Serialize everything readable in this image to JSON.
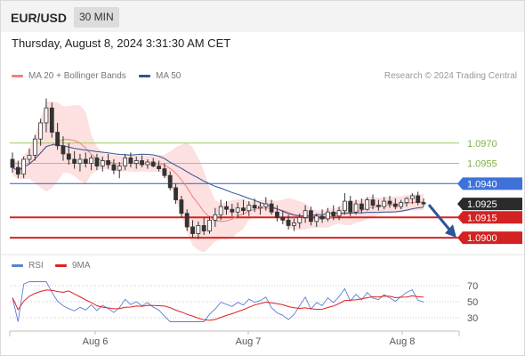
{
  "header": {
    "pair": "EUR/USD",
    "timeframe": "30 MIN"
  },
  "datetime": "Thursday, August 8, 2024 3:31:30 AM CET",
  "legend": [
    {
      "label": "MA 20 + Bollinger Bands",
      "color": "#f08080"
    },
    {
      "label": "MA 50",
      "color": "#2e5597"
    }
  ],
  "credit": "Research © 2024 Trading Central",
  "price_levels": [
    {
      "label": "1.0970",
      "value": 1.097,
      "kind": "resistance-weak",
      "color": "#9ccc65"
    },
    {
      "label": "1.0955",
      "value": 1.0955,
      "kind": "resistance-weak",
      "color": "#9ccc65"
    },
    {
      "label": "1.0940",
      "value": 1.094,
      "kind": "pivot",
      "color": "#3f72d8"
    },
    {
      "label": "1.0925",
      "value": 1.0925,
      "kind": "last-price",
      "color": "#2b2b2b"
    },
    {
      "label": "1.0915",
      "value": 1.0915,
      "kind": "support",
      "color": "#d32222"
    },
    {
      "label": "1.0900",
      "value": 1.09,
      "kind": "support",
      "color": "#d32222"
    }
  ],
  "rsi_legend": [
    {
      "label": "RSI",
      "color": "#5b7fd6"
    },
    {
      "label": "9MA",
      "color": "#e02020"
    }
  ],
  "rsi_levels": [
    "70",
    "50",
    "30"
  ],
  "x_labels": [
    "Aug 6",
    "Aug 7",
    "Aug 8"
  ],
  "chart_data": {
    "type": "candlestick",
    "price_range": [
      1.08915,
      1.101
    ],
    "candles_ohlc": [
      [
        1.0958,
        1.0963,
        1.0948,
        1.0952
      ],
      [
        1.0952,
        1.0957,
        1.0944,
        1.0947
      ],
      [
        1.0947,
        1.096,
        1.0944,
        1.0958
      ],
      [
        1.0958,
        1.0966,
        1.0955,
        1.0961
      ],
      [
        1.0961,
        1.0976,
        1.0957,
        1.0973
      ],
      [
        1.0973,
        1.0988,
        1.0968,
        1.0985
      ],
      [
        1.0985,
        1.1003,
        1.0978,
        1.0996
      ],
      [
        1.0996,
        1.1,
        1.0974,
        1.0978
      ],
      [
        1.0978,
        1.0985,
        1.0965,
        1.0968
      ],
      [
        1.0968,
        1.0975,
        1.0957,
        1.0962
      ],
      [
        1.0962,
        1.097,
        1.0954,
        1.0958
      ],
      [
        1.0958,
        1.0964,
        1.0951,
        1.0955
      ],
      [
        1.0955,
        1.0962,
        1.0949,
        1.0958
      ],
      [
        1.0958,
        1.0963,
        1.0952,
        1.0955
      ],
      [
        1.0955,
        1.0961,
        1.095,
        1.0959
      ],
      [
        1.0959,
        1.0962,
        1.095,
        1.0953
      ],
      [
        1.0953,
        1.096,
        1.0949,
        1.0957
      ],
      [
        1.0957,
        1.0962,
        1.0951,
        1.0954
      ],
      [
        1.0954,
        1.0958,
        1.0947,
        1.095
      ],
      [
        1.095,
        1.0956,
        1.0944,
        1.0953
      ],
      [
        1.0953,
        1.0962,
        1.095,
        1.0959
      ],
      [
        1.0959,
        1.0963,
        1.0952,
        1.0955
      ],
      [
        1.0955,
        1.096,
        1.0951,
        1.0957
      ],
      [
        1.0957,
        1.0961,
        1.0952,
        1.0954
      ],
      [
        1.0954,
        1.0958,
        1.0951,
        1.0956
      ],
      [
        1.0956,
        1.0959,
        1.0952,
        1.0953
      ],
      [
        1.0953,
        1.0957,
        1.0949,
        1.0951
      ],
      [
        1.0951,
        1.0955,
        1.0944,
        1.0946
      ],
      [
        1.0946,
        1.0949,
        1.0935,
        1.0937
      ],
      [
        1.0937,
        1.094,
        1.0925,
        1.0928
      ],
      [
        1.0928,
        1.0931,
        1.0915,
        1.0918
      ],
      [
        1.0918,
        1.0921,
        1.0905,
        1.0908
      ],
      [
        1.0908,
        1.0913,
        1.09,
        1.0903
      ],
      [
        1.0903,
        1.0912,
        1.0899,
        1.0909
      ],
      [
        1.0909,
        1.0915,
        1.0902,
        1.0905
      ],
      [
        1.0905,
        1.0916,
        1.0903,
        1.0913
      ],
      [
        1.0913,
        1.0922,
        1.0908,
        1.0917
      ],
      [
        1.0917,
        1.0928,
        1.0913,
        1.0923
      ],
      [
        1.0923,
        1.0927,
        1.0917,
        1.0921
      ],
      [
        1.0921,
        1.0925,
        1.0916,
        1.0919
      ],
      [
        1.0919,
        1.0926,
        1.0915,
        1.0922
      ],
      [
        1.0922,
        1.0928,
        1.0917,
        1.092
      ],
      [
        1.092,
        1.0927,
        1.0916,
        1.0924
      ],
      [
        1.0924,
        1.0929,
        1.0919,
        1.0922
      ],
      [
        1.0922,
        1.0926,
        1.0917,
        1.0923
      ],
      [
        1.0923,
        1.093,
        1.092,
        1.0925
      ],
      [
        1.0925,
        1.0928,
        1.0917,
        1.0919
      ],
      [
        1.0919,
        1.0924,
        1.0912,
        1.0915
      ],
      [
        1.0915,
        1.092,
        1.091,
        1.0913
      ],
      [
        1.0913,
        1.0917,
        1.0906,
        1.0909
      ],
      [
        1.0909,
        1.0914,
        1.0905,
        1.0911
      ],
      [
        1.0911,
        1.0918,
        1.0907,
        1.0915
      ],
      [
        1.0915,
        1.0924,
        1.0911,
        1.092
      ],
      [
        1.092,
        1.0923,
        1.0909,
        1.0912
      ],
      [
        1.0912,
        1.0918,
        1.0908,
        1.0916
      ],
      [
        1.0916,
        1.0921,
        1.0911,
        1.0914
      ],
      [
        1.0914,
        1.0922,
        1.0912,
        1.0919
      ],
      [
        1.0919,
        1.0924,
        1.0913,
        1.0916
      ],
      [
        1.0916,
        1.0923,
        1.0913,
        1.092
      ],
      [
        1.092,
        1.0933,
        1.0917,
        1.0927
      ],
      [
        1.0927,
        1.0931,
        1.0916,
        1.0919
      ],
      [
        1.0919,
        1.0928,
        1.0917,
        1.0925
      ],
      [
        1.0925,
        1.0929,
        1.0918,
        1.0921
      ],
      [
        1.0921,
        1.093,
        1.092,
        1.0928
      ],
      [
        1.0928,
        1.0932,
        1.0921,
        1.0924
      ],
      [
        1.0924,
        1.0928,
        1.092,
        1.0923
      ],
      [
        1.0923,
        1.093,
        1.0921,
        1.0927
      ],
      [
        1.0927,
        1.0931,
        1.0922,
        1.0925
      ],
      [
        1.0925,
        1.0929,
        1.0921,
        1.0923
      ],
      [
        1.0923,
        1.0928,
        1.0921,
        1.0926
      ],
      [
        1.0926,
        1.093,
        1.0923,
        1.0929
      ],
      [
        1.0929,
        1.0933,
        1.0925,
        1.0931
      ],
      [
        1.0931,
        1.0934,
        1.0924,
        1.0926
      ],
      [
        1.0926,
        1.0929,
        1.0923,
        1.0925
      ]
    ],
    "rsi_range": [
      20,
      80
    ]
  }
}
